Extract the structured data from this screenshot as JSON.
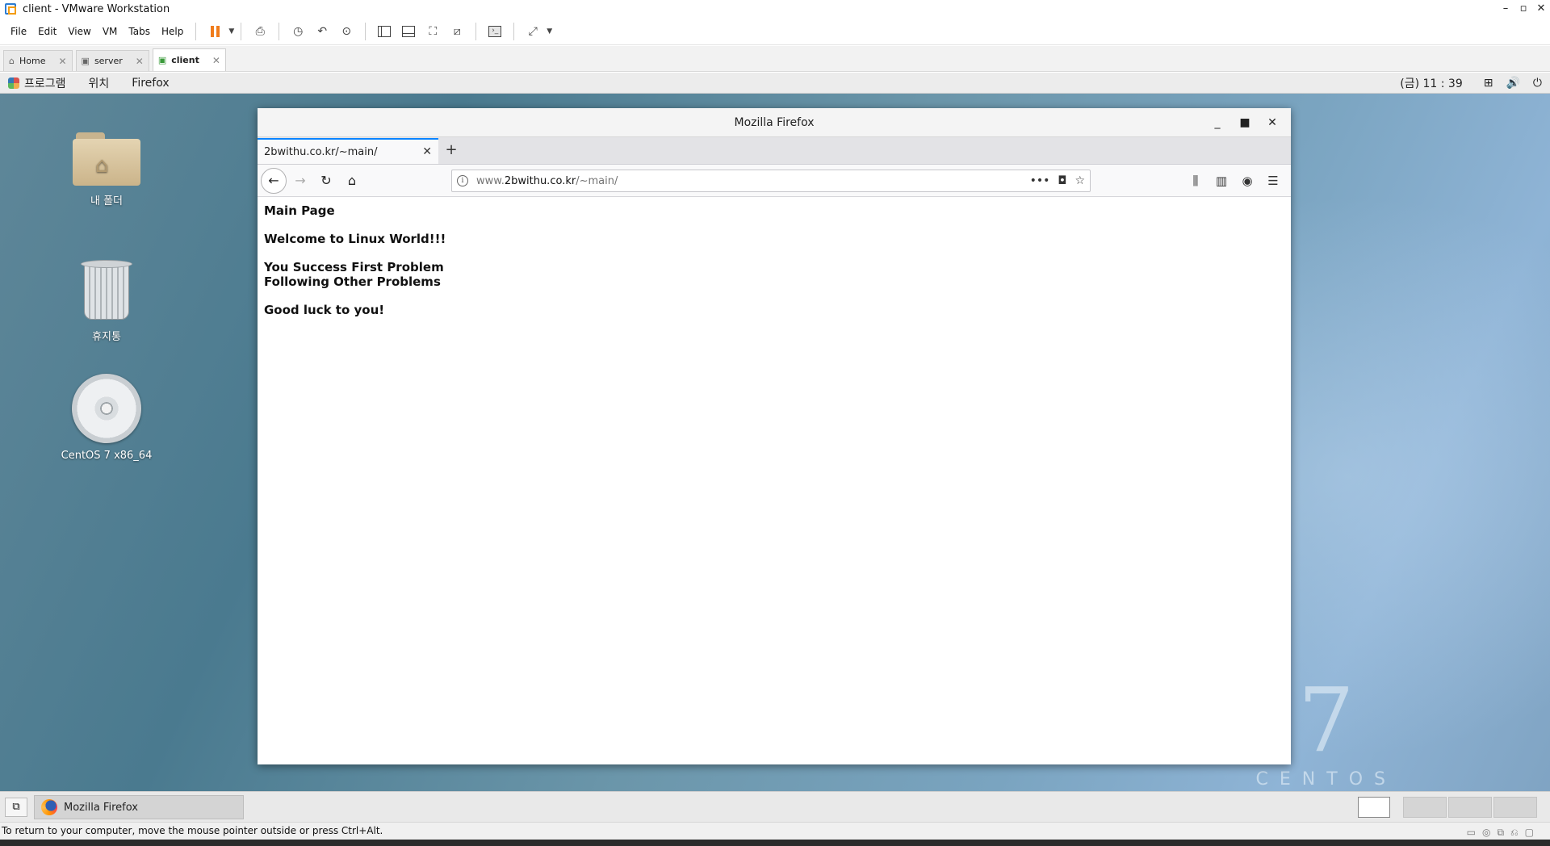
{
  "vmware": {
    "window_title": "client - VMware Workstation",
    "menu": [
      "File",
      "Edit",
      "View",
      "VM",
      "Tabs",
      "Help"
    ],
    "tabs": [
      {
        "label": "Home",
        "icon": "home-icon"
      },
      {
        "label": "server",
        "icon": "vm-icon"
      },
      {
        "label": "client",
        "icon": "vm-icon",
        "active": true
      }
    ],
    "status_message": "To return to your computer, move the mouse pointer outside or press Ctrl+Alt."
  },
  "gnome": {
    "menu": [
      "프로그램",
      "위치",
      "Firefox"
    ],
    "clock": "(금) 11 : 39",
    "desktop_icons": [
      "내 폴더",
      "휴지통",
      "CentOS 7 x86_64"
    ],
    "taskbar_window": "Mozilla Firefox",
    "watermark_number": "7",
    "watermark_word": "CENTOS"
  },
  "firefox": {
    "window_title": "Mozilla Firefox",
    "tab_title": "2bwithu.co.kr/~main/",
    "url_prefix": "www.",
    "url_domain": "2bwithu.co.kr",
    "url_path": "/~main/",
    "content": {
      "heading": "Main Page",
      "welcome": "Welcome to Linux World!!!",
      "line1": "You Success First Problem",
      "line2": "Following Other Problems",
      "closing": "Good luck to you!"
    }
  },
  "colors": {
    "firefox_tab_accent": "#0a84ff",
    "vmware_pause": "#f07c1c"
  }
}
